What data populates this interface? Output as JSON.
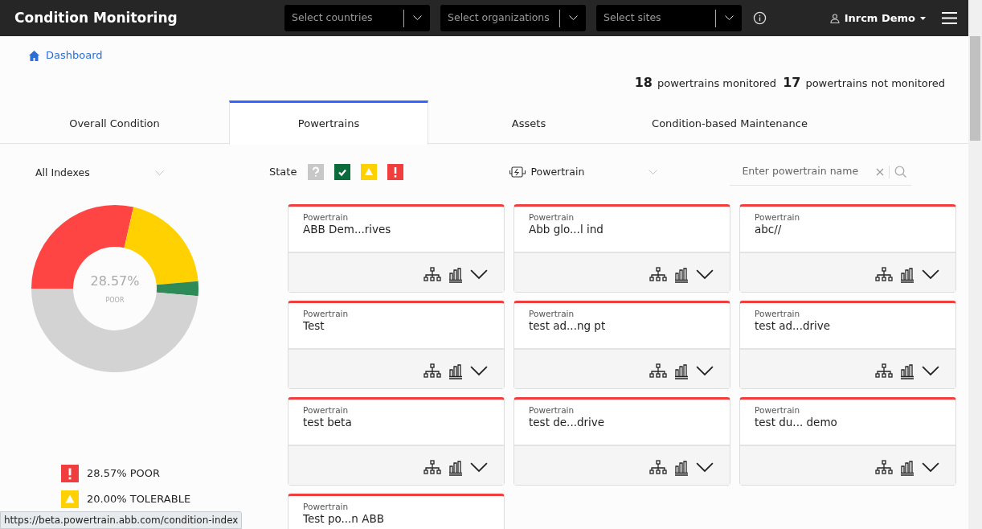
{
  "header": {
    "title": "Condition Monitoring",
    "filters": [
      {
        "placeholder": "Select countries"
      },
      {
        "placeholder": "Select organizations"
      },
      {
        "placeholder": "Select sites"
      }
    ],
    "user": "Inrcm Demo"
  },
  "breadcrumb": "Dashboard",
  "summary": [
    {
      "count": "18",
      "label": "powertrains monitored"
    },
    {
      "count": "17",
      "label": "powertrains not monitored"
    }
  ],
  "tabs": [
    {
      "label": "Overall Condition",
      "selected": false
    },
    {
      "label": "Powertrains",
      "selected": true
    },
    {
      "label": "Assets",
      "selected": false
    },
    {
      "label": "Condition-based Maintenance",
      "selected": false
    }
  ],
  "index_select": "All Indexes",
  "state_filter": {
    "label": "State",
    "items": [
      {
        "kind": "unknown",
        "color": "#c8c8c8"
      },
      {
        "kind": "good",
        "color": "#0c6b3a"
      },
      {
        "kind": "tolerable",
        "color": "#ffd100"
      },
      {
        "kind": "poor",
        "color": "#f03e3e"
      }
    ]
  },
  "type_select": "Powertrain",
  "search": {
    "placeholder": "Enter powertrain name"
  },
  "donut": {
    "center_value": "28.57%",
    "center_label": "POOR",
    "chart_data": {
      "type": "donut",
      "values": [
        28.57,
        20.0,
        2.86,
        48.57
      ],
      "colors": [
        "#ff4444",
        "#ffd100",
        "#2e8b57",
        "#d3d3d3"
      ]
    }
  },
  "legend": [
    {
      "kind": "poor",
      "color": "#f03e3e",
      "label": "28.57% POOR"
    },
    {
      "kind": "tolerable",
      "color": "#ffd100",
      "label": "20.00% TOLERABLE"
    }
  ],
  "cards": [
    {
      "type": "Powertrain",
      "name": "ABB Dem...rives"
    },
    {
      "type": "Powertrain",
      "name": "Abb glo...l ind"
    },
    {
      "type": "Powertrain",
      "name": "abc//"
    },
    {
      "type": "Powertrain",
      "name": "Test"
    },
    {
      "type": "Powertrain",
      "name": "test ad...ng pt"
    },
    {
      "type": "Powertrain",
      "name": "test ad...drive"
    },
    {
      "type": "Powertrain",
      "name": "test beta"
    },
    {
      "type": "Powertrain",
      "name": "test de...drive"
    },
    {
      "type": "Powertrain",
      "name": "test du... demo"
    },
    {
      "type": "Powertrain",
      "name": "Test po...n ABB"
    }
  ],
  "status_url": "https://beta.powertrain.abb.com/condition-index"
}
